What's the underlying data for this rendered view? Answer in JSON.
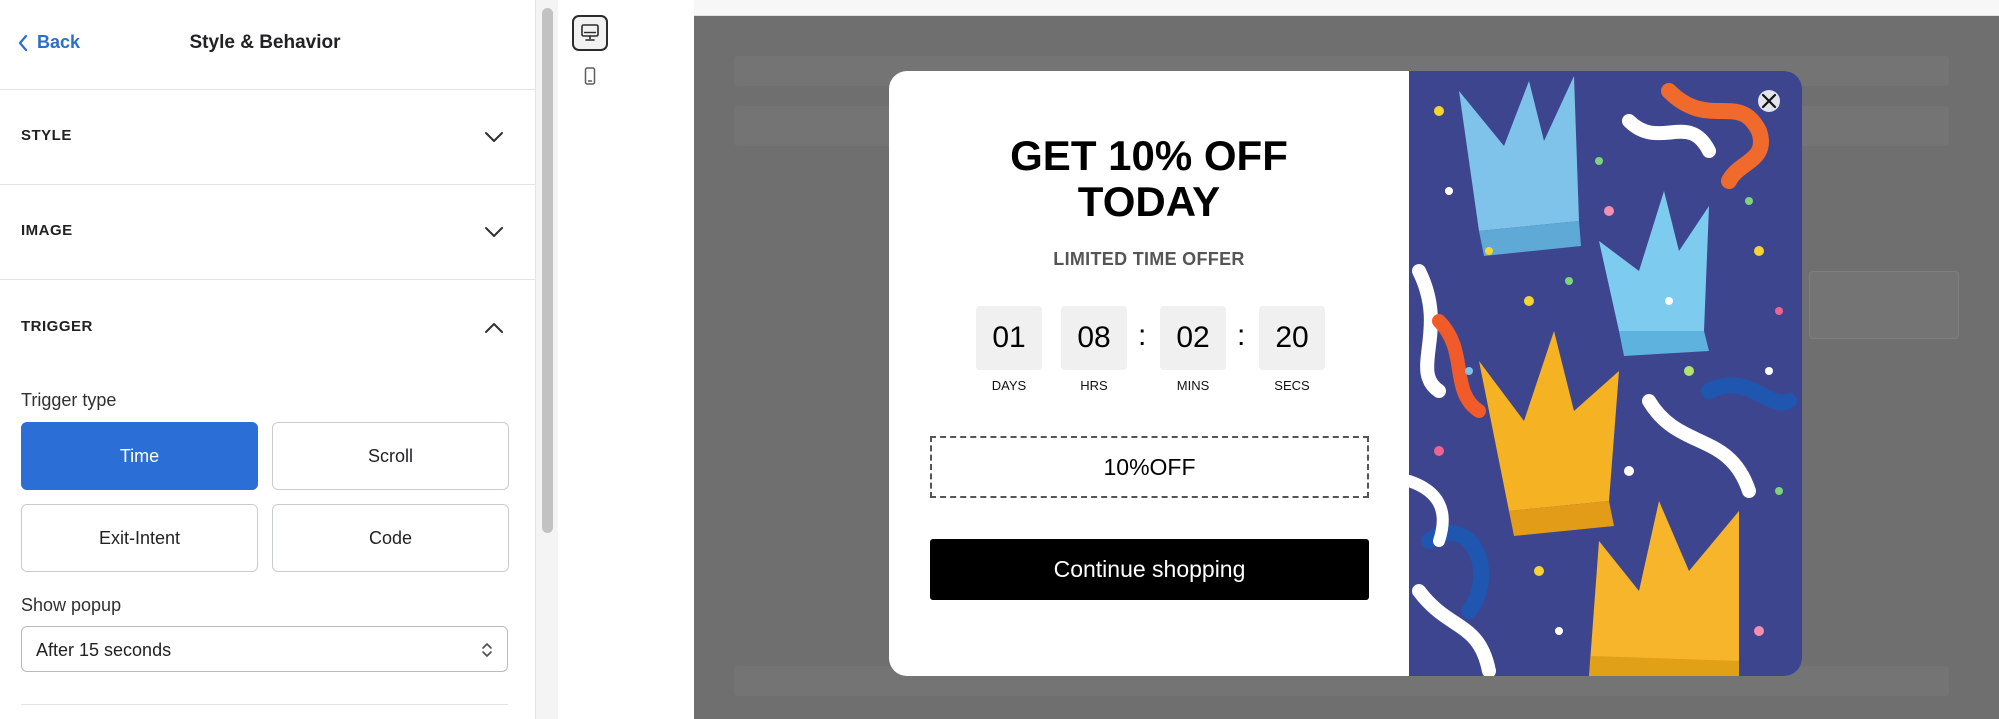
{
  "panel": {
    "back_label": "Back",
    "title": "Style & Behavior",
    "sections": {
      "style": "STYLE",
      "image": "IMAGE",
      "trigger": "TRIGGER"
    },
    "trigger": {
      "type_label": "Trigger type",
      "options": [
        "Time",
        "Scroll",
        "Exit-Intent",
        "Code"
      ],
      "selected": "Time",
      "show_label": "Show popup",
      "show_value": "After 15 seconds"
    }
  },
  "devices": {
    "desktop_icon": "desktop-icon",
    "mobile_icon": "mobile-icon",
    "active": "desktop"
  },
  "popup": {
    "headline": "GET 10% OFF TODAY",
    "subhead": "LIMITED TIME OFFER",
    "countdown": [
      {
        "value": "01",
        "label": "DAYS"
      },
      {
        "value": "08",
        "label": "HRS"
      },
      {
        "value": "02",
        "label": "MINS"
      },
      {
        "value": "20",
        "label": "SECS"
      }
    ],
    "separator": ":",
    "coupon_code": "10%OFF",
    "cta_label": "Continue shopping",
    "close_icon": "close-icon"
  },
  "colors": {
    "accent": "#2b6fd6",
    "link": "#2c6ecb",
    "overlay": "#6f6f6f",
    "cta_bg": "#000000",
    "image_bg": "#3e458f"
  }
}
